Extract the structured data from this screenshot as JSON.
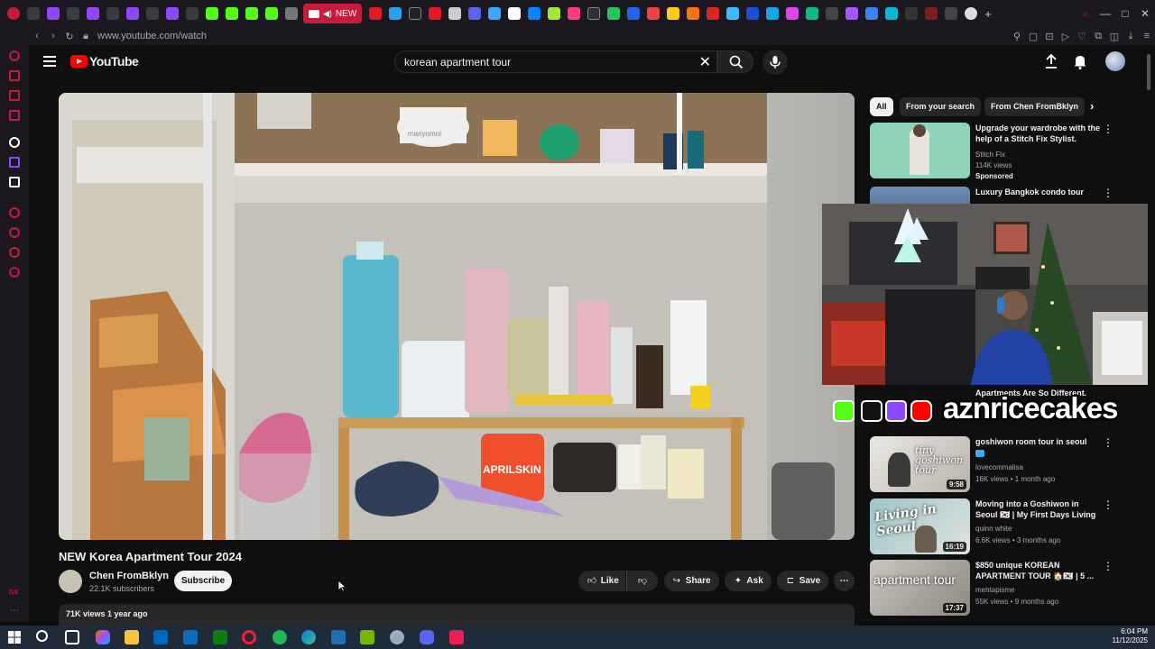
{
  "browser": {
    "active_tab_label": "NEW",
    "url": "www.youtube.com/watch",
    "window_controls": [
      "—",
      "□",
      "✕"
    ]
  },
  "masthead": {
    "logo_text": "YouTube",
    "search_query": "korean apartment tour",
    "clear_glyph": "✕"
  },
  "video": {
    "title": "NEW Korea Apartment Tour 2024",
    "thumb_labels": {
      "jar": "manyomoi",
      "red_tin": "APRILSKIN"
    },
    "channel": {
      "name": "Chen FromBklyn",
      "subscribers": "22.1K subscribers"
    },
    "subscribe_label": "Subscribe",
    "actions": {
      "like": "Like",
      "share": "Share",
      "ask": "Ask",
      "save": "Save"
    },
    "meta": "71K views  1 year ago"
  },
  "chips": [
    "All",
    "From your search",
    "From Chen FromBklyn"
  ],
  "recommendations": [
    {
      "title": "Upgrade your wardrobe with the help of a Stitch Fix Stylist.",
      "lines": [
        "Stitch Fix",
        "114K views",
        "Sponsored"
      ],
      "duration": ""
    },
    {
      "title": "Luxury Bangkok condo tour",
      "lines": [],
      "duration": ""
    },
    {
      "title": "Apartments Are So Different.",
      "lines": [],
      "duration": ""
    },
    {
      "title": "goshiwon room tour in seoul",
      "lines": [
        "lovecommalisa",
        "16K views • 1 month ago"
      ],
      "duration": "9:58",
      "thumb_text": "tiny goshiwon tour"
    },
    {
      "title": "Moving into a Goshiwon in Seoul 🇰🇷 | My First Days Living ...",
      "lines": [
        "quinn white",
        "6.6K views • 3 months ago"
      ],
      "duration": "16:19",
      "thumb_text": "Living in Seoul"
    },
    {
      "title": "$850 unique KOREAN APARTMENT TOUR 🏠🇰🇷 | 5 ...",
      "lines": [
        "mehtapisme",
        "55K views • 9 months ago"
      ],
      "duration": "17:37",
      "thumb_text": "apartment tour"
    }
  ],
  "overlay": {
    "streamer_name": "aznricecakes"
  },
  "taskbar": {
    "time": "6:04 PM",
    "date": "11/12/2025"
  },
  "colors": {
    "youtube_red": "#ff0000",
    "opera_red": "#c51c3a",
    "bg": "#0f0f0f",
    "pill": "#272727"
  }
}
